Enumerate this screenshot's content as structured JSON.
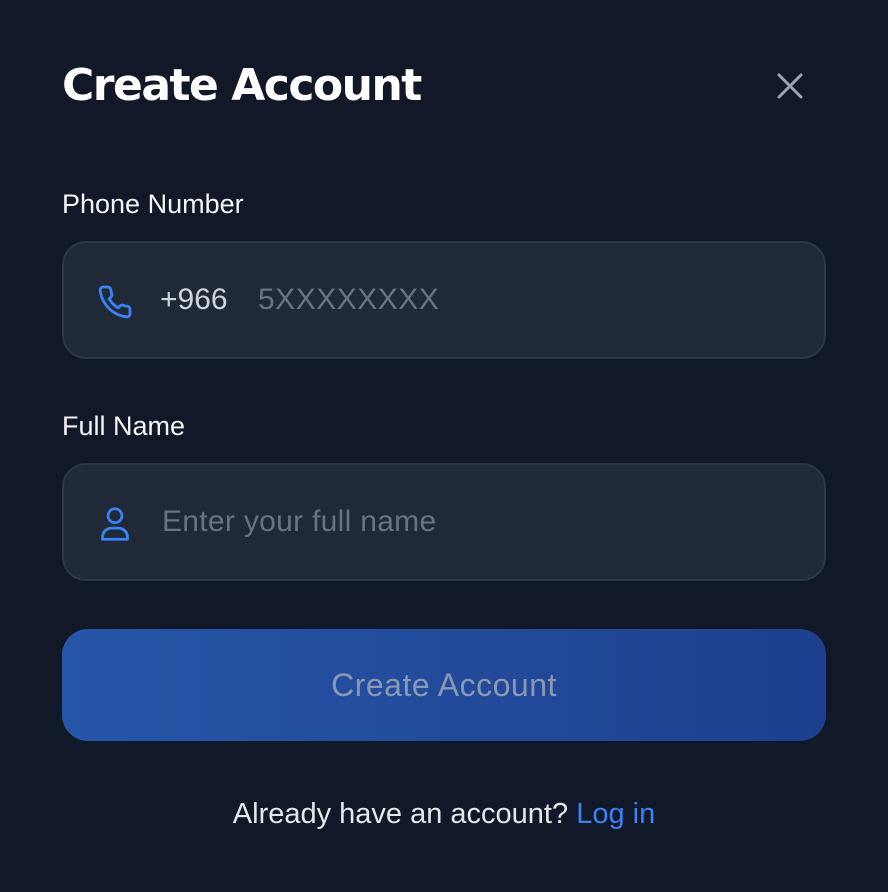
{
  "modal": {
    "title": "Create Account",
    "close_icon": "close-icon"
  },
  "phone": {
    "label": "Phone Number",
    "icon": "phone-icon",
    "prefix": "+966",
    "value": "",
    "placeholder": "5XXXXXXXX"
  },
  "full_name": {
    "label": "Full Name",
    "icon": "user-icon",
    "value": "",
    "placeholder": "Enter your full name"
  },
  "submit": {
    "label": "Create Account"
  },
  "footer": {
    "text": "Already have an account?",
    "link_label": "Log in"
  },
  "colors": {
    "background": "#111827",
    "input_background": "#1f2937",
    "accent": "#3b82f6",
    "button_gradient_start": "#2656a8",
    "button_gradient_end": "#1e3f8f"
  }
}
